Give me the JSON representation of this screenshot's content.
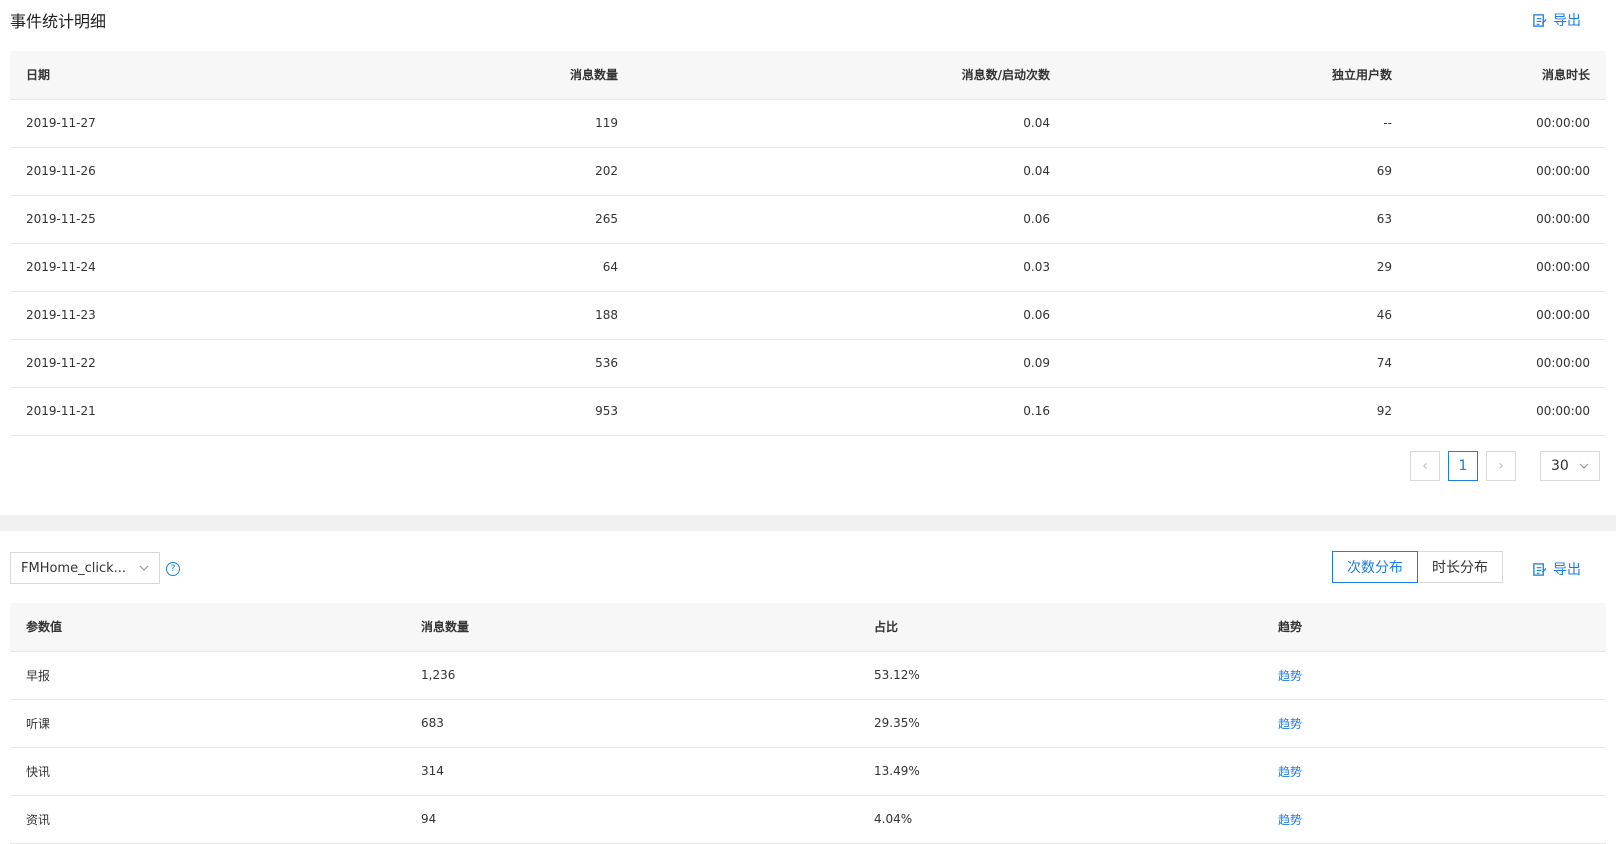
{
  "top": {
    "title": "事件统计明细",
    "export_label": "导出",
    "columns": [
      "日期",
      "消息数量",
      "消息数/启动次数",
      "独立用户数",
      "消息时长"
    ],
    "rows": [
      [
        "2019-11-27",
        "119",
        "0.04",
        "--",
        "00:00:00"
      ],
      [
        "2019-11-26",
        "202",
        "0.04",
        "69",
        "00:00:00"
      ],
      [
        "2019-11-25",
        "265",
        "0.06",
        "63",
        "00:00:00"
      ],
      [
        "2019-11-24",
        "64",
        "0.03",
        "29",
        "00:00:00"
      ],
      [
        "2019-11-23",
        "188",
        "0.06",
        "46",
        "00:00:00"
      ],
      [
        "2019-11-22",
        "536",
        "0.09",
        "74",
        "00:00:00"
      ],
      [
        "2019-11-21",
        "953",
        "0.16",
        "92",
        "00:00:00"
      ]
    ],
    "pagination": {
      "prev": "‹",
      "current_page": "1",
      "next": "›",
      "page_size": "30"
    }
  },
  "bottom": {
    "param_select_value": "FMHome_click...",
    "help_icon": "?",
    "tabs": [
      "次数分布",
      "时长分布"
    ],
    "export_label": "导出",
    "columns": [
      "参数值",
      "消息数量",
      "占比",
      "趋势"
    ],
    "rows": [
      [
        "早报",
        "1,236",
        "53.12%",
        "趋势"
      ],
      [
        "听课",
        "683",
        "29.35%",
        "趋势"
      ],
      [
        "快讯",
        "314",
        "13.49%",
        "趋势"
      ],
      [
        "资讯",
        "94",
        "4.04%",
        "趋势"
      ]
    ]
  },
  "colors": {
    "accent": "#1c7fe0",
    "header_bg": "#f7f7f7",
    "divider": "#f0f0f0"
  },
  "icons": {
    "export": "export-icon",
    "dropdown": "chevron-down-icon",
    "help": "help-icon"
  }
}
